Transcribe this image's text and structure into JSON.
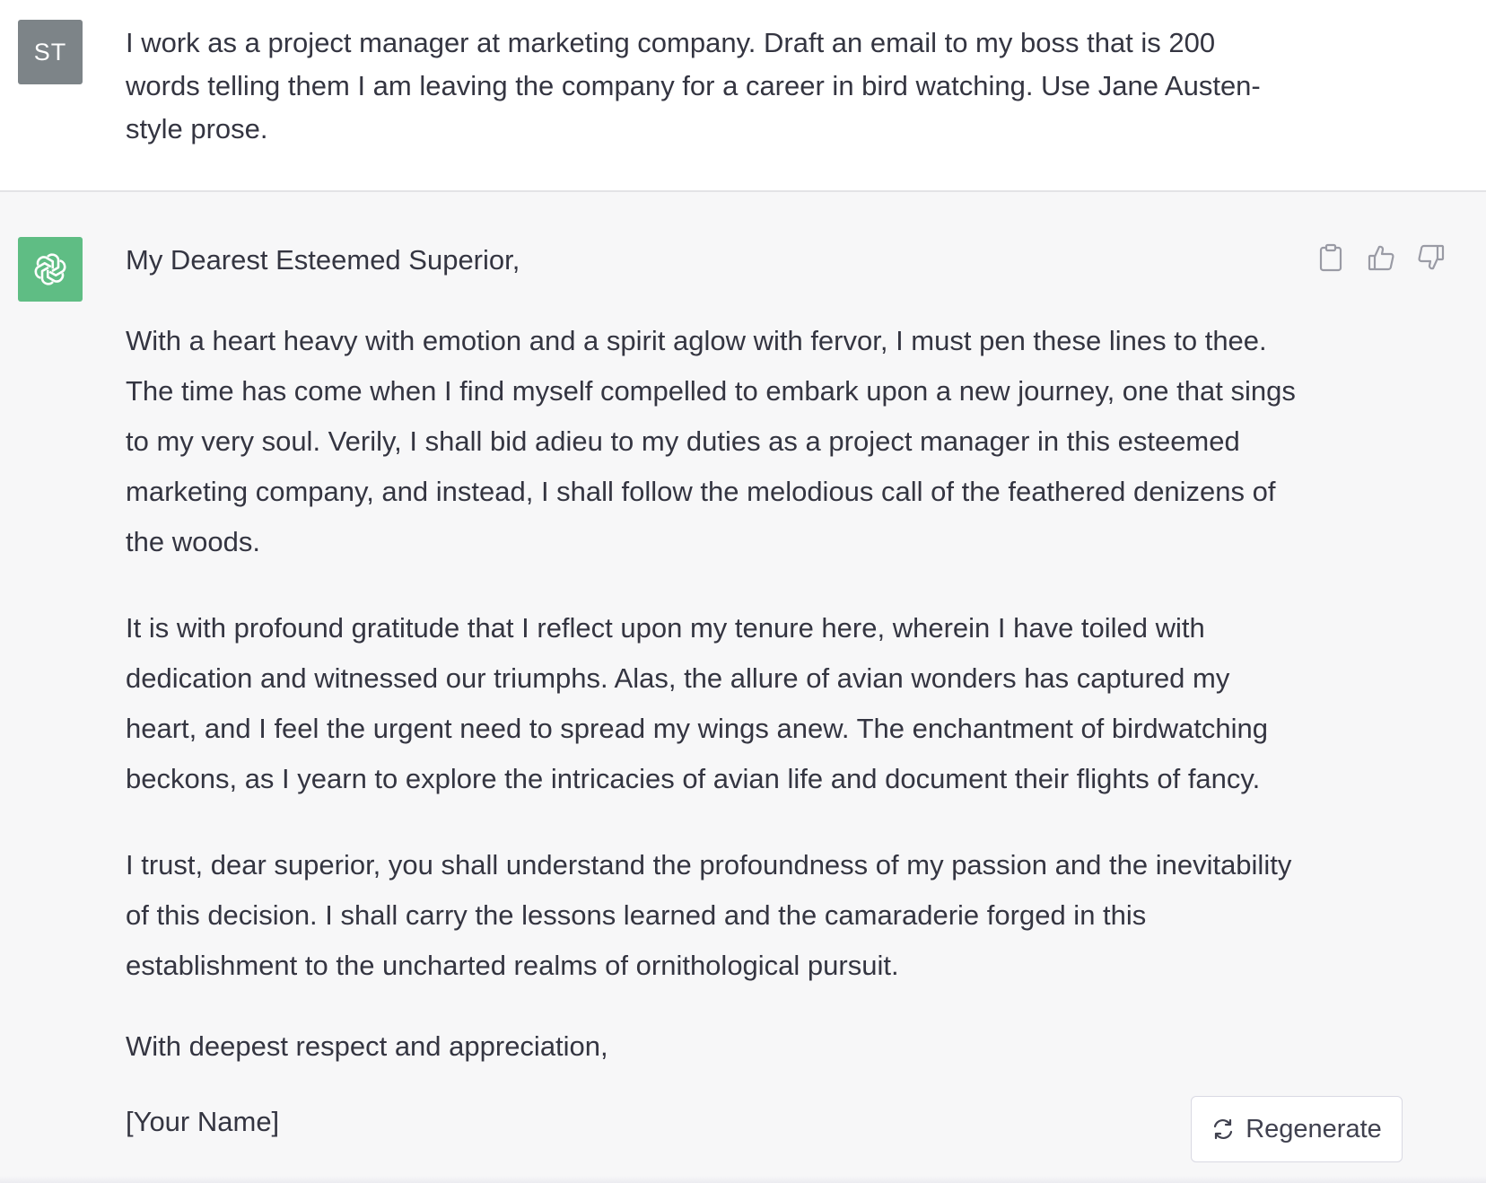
{
  "user_message": {
    "avatar_initials": "ST",
    "text": "I work as a project manager at marketing company. Draft an email to my boss that is 200 words telling them I am leaving the company for a career in bird watching. Use Jane Austen-style prose."
  },
  "assistant_message": {
    "greeting": "My Dearest Esteemed Superior,",
    "paragraphs": [
      "With a heart heavy with emotion and a spirit aglow with fervor, I must pen these lines to thee. The time has come when I find myself compelled to embark upon a new journey, one that sings to my very soul. Verily, I shall bid adieu to my duties as a project manager in this esteemed marketing company, and instead, I shall follow the melodious call of the feathered denizens of the woods.",
      "It is with profound gratitude that I reflect upon my tenure here, wherein I have toiled with dedication and witnessed our triumphs. Alas, the allure of avian wonders has captured my heart, and I feel the urgent need to spread my wings anew. The enchantment of birdwatching beckons, as I yearn to explore the intricacies of avian life and document their flights of fancy.",
      "I trust, dear superior, you shall understand the profoundness of my passion and the inevitability of this decision. I shall carry the lessons learned and the camaraderie forged in this establishment to the uncharted realms of ornithological pursuit."
    ],
    "closing": "With deepest respect and appreciation,",
    "signature": "[Your Name]"
  },
  "actions": {
    "copy_icon": "clipboard-icon",
    "like_icon": "thumbs-up-icon",
    "dislike_icon": "thumbs-down-icon"
  },
  "regenerate": {
    "label": "Regenerate",
    "icon": "refresh-icon"
  },
  "colors": {
    "user_avatar_bg": "#7d8488",
    "bot_avatar_bg": "#5fbd84",
    "assistant_bg": "#f7f7f8",
    "text": "#343541"
  }
}
